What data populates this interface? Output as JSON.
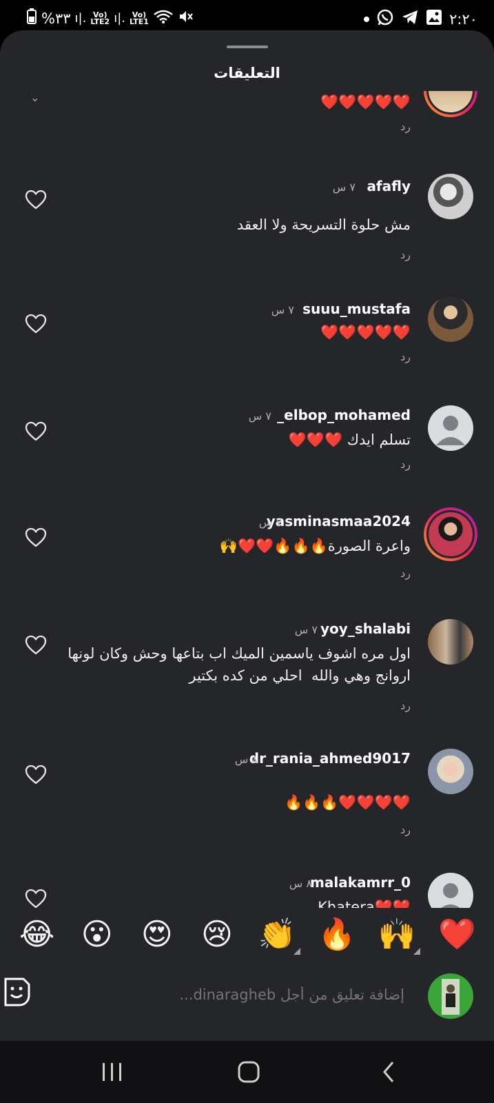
{
  "status": {
    "battery": "%٣٣",
    "sim2": "LTE2",
    "sim1": "LTE1",
    "time": "٢:٢٠"
  },
  "sheet": {
    "title": "التعليقات"
  },
  "reply_label": "رد",
  "comments": [
    {
      "username": "",
      "time": "",
      "text": "❤️❤️❤️❤️❤️",
      "partial": true
    },
    {
      "username": "afafly",
      "time": "٧ س",
      "text": "مش حلوة التسريحة ولا العقد"
    },
    {
      "username": "suuu_mustafa",
      "time": "٧ س",
      "text": "❤️❤️❤️❤️❤️"
    },
    {
      "username": "_elbop_mohamed",
      "time": "٧ س",
      "text": "تسلم ايدك ❤️❤️❤️"
    },
    {
      "username": "yasminasmaa2024",
      "time": "٧ س",
      "text": "واعرة الصورة🔥🔥🔥❤️❤️🙌"
    },
    {
      "username": "yoy_shalabi",
      "time": "٧ س",
      "text": "اول مره اشوف ياسمين الميك اب بتاعها وحش وكان لونها اروانج وهي والله  احلي من كده بكتير"
    },
    {
      "username": "dr_rania_ahmed9017",
      "time": "٨ س",
      "text": "❤️❤️❤️❤️🔥🔥🔥"
    },
    {
      "username": "malakamrr_0",
      "time": "٨ س",
      "text": "❤️❤️Khatera"
    }
  ],
  "quick_reactions": [
    "❤️",
    "🙌",
    "🔥",
    "👏",
    "😢",
    "😍",
    "😮",
    "😂"
  ],
  "composer": {
    "placeholder": "إضافة تعليق من أجل dinaragheb..."
  },
  "colors": {
    "sheet_bg": "#25262a",
    "accent_ring": "#e91e63",
    "muted": "#a7a7a7"
  }
}
